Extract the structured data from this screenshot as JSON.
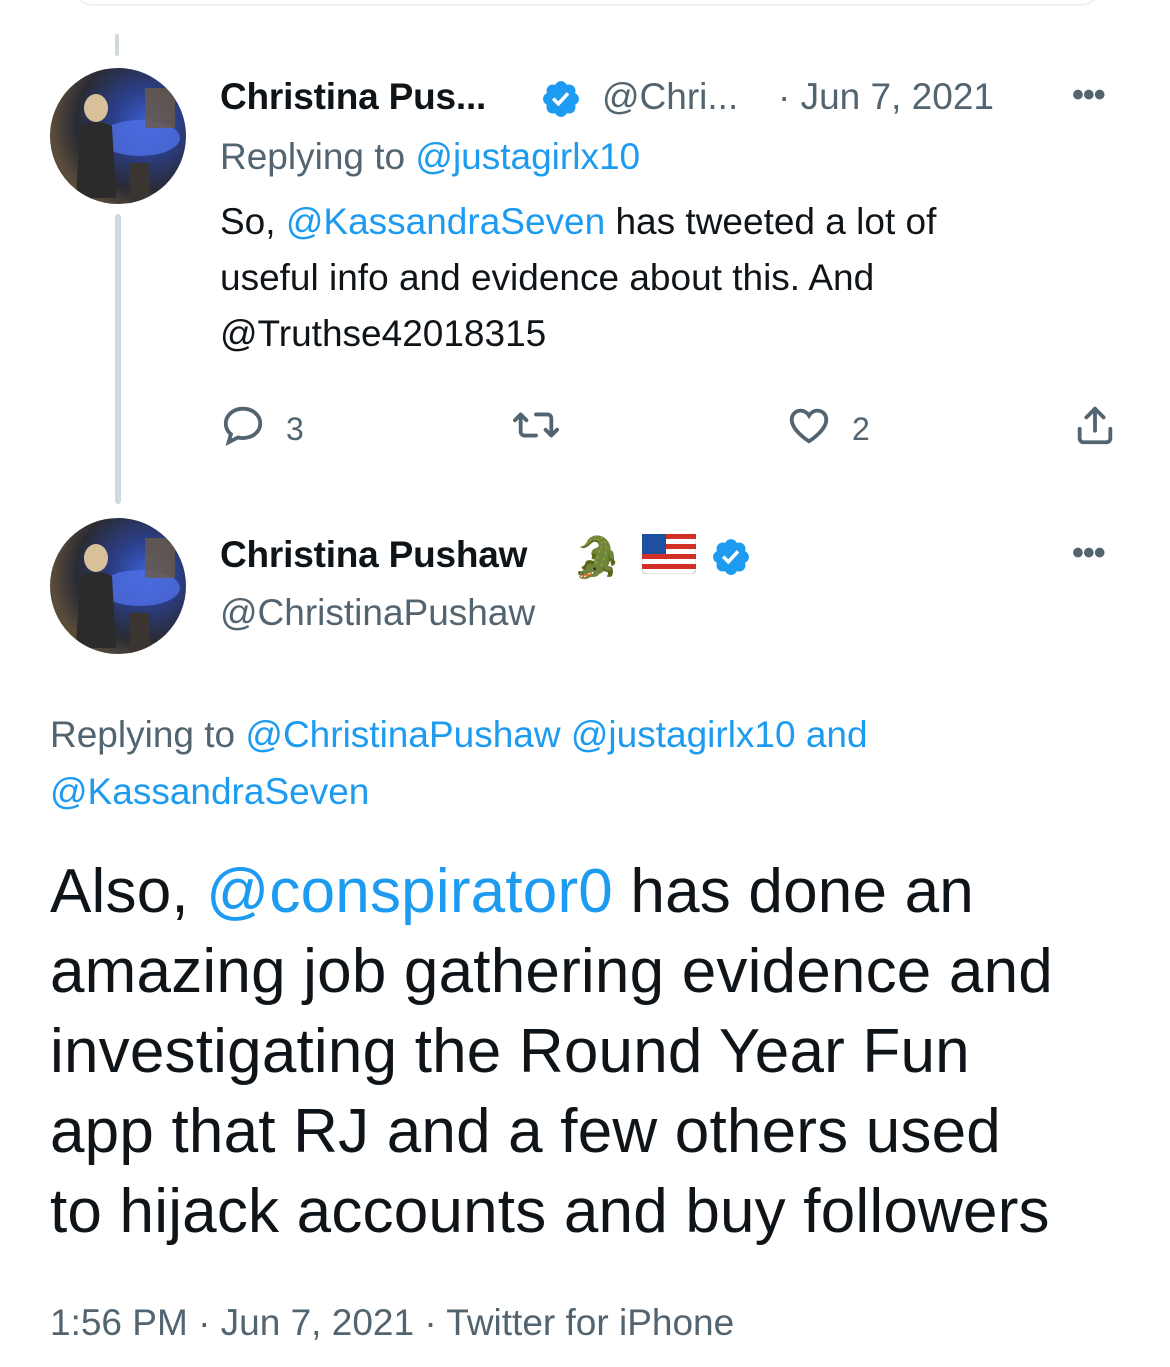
{
  "tweet1": {
    "display_name": "Christina Pus...",
    "handle": "@Chri...",
    "date": "· Jun 7, 2021",
    "replying_label": "Replying to ",
    "replying_handle": "@justagirlx10",
    "text_before": "So, ",
    "text_mention": "@KassandraSeven",
    "text_line1_after": " has tweeted a lot of",
    "text_line2": "useful info and evidence about this. And",
    "text_line3": "@Truthse42018315",
    "reply_count": "3",
    "like_count": "2"
  },
  "tweet2": {
    "display_name": "Christina Pushaw",
    "emoji_alligator": "🐊",
    "emoji_flag": "🇺🇸",
    "handle": "@ChristinaPushaw",
    "replying_label": "Replying to ",
    "replying_handles": "@ChristinaPushaw @justagirlx10 and",
    "replying_handles_2": "@KassandraSeven",
    "text_line1_before": "Also, ",
    "text_line1_mention": "@conspirator0",
    "text_line1_after": " has done an",
    "text_line2": "amazing job gathering evidence and",
    "text_line3": "investigating the Round Year Fun",
    "text_line4": "app that RJ and a few others used",
    "text_line5": "to hijack accounts and buy followers",
    "timestamp": "1:56 PM · Jun 7, 2021 · ",
    "source": "Twitter for iPhone"
  },
  "icons": {
    "more": "•••",
    "verified": "verified-badge-icon",
    "reply": "reply-icon",
    "retweet": "retweet-icon",
    "like": "like-icon",
    "share": "share-icon"
  },
  "colors": {
    "link": "#1d9bf0",
    "secondary": "#536471",
    "text": "#0f1419",
    "thread_line": "#cfd9de"
  }
}
